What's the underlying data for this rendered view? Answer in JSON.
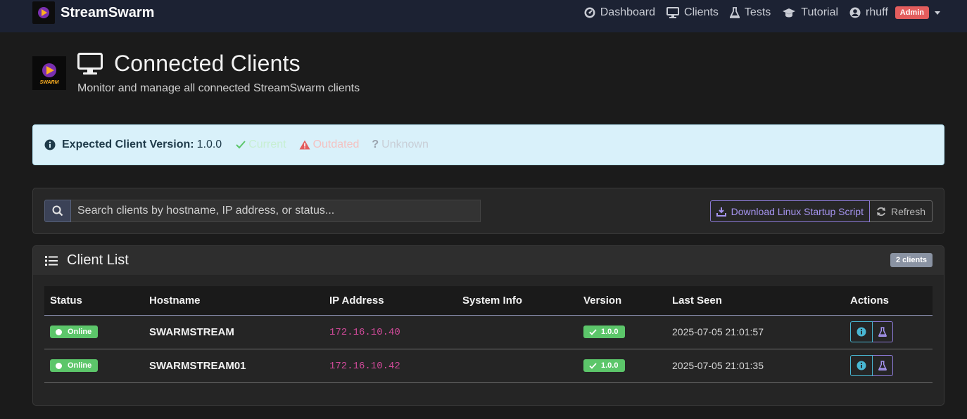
{
  "navbar": {
    "brand": "StreamSwarm",
    "logo_text": "SWARM",
    "links": [
      {
        "label": "Dashboard",
        "icon": "dashboard-icon"
      },
      {
        "label": "Clients",
        "icon": "monitor-icon"
      },
      {
        "label": "Tests",
        "icon": "flask-icon"
      },
      {
        "label": "Tutorial",
        "icon": "graduation-cap-icon"
      }
    ],
    "user": "rhuff",
    "role_badge": "Admin"
  },
  "header": {
    "title": "Connected Clients",
    "subtitle": "Monitor and manage all connected StreamSwarm clients",
    "logo_text": "SWARM"
  },
  "alert": {
    "label": "Expected Client Version:",
    "version": "1.0.0",
    "legend": {
      "current": "Current",
      "outdated": "Outdated",
      "unknown": "Unknown"
    }
  },
  "search": {
    "placeholder": "Search clients by hostname, IP address, or status...",
    "value": ""
  },
  "toolbar": {
    "download_label": "Download Linux Startup Script",
    "refresh_label": "Refresh"
  },
  "client_list": {
    "title": "Client List",
    "count_badge": "2 clients",
    "columns": [
      "Status",
      "Hostname",
      "IP Address",
      "System Info",
      "Version",
      "Last Seen",
      "Actions"
    ],
    "rows": [
      {
        "status": "Online",
        "hostname": "SWARMSTREAM",
        "ip": "172.16.10.40",
        "system_info": "",
        "version": "1.0.0",
        "last_seen": "2025-07-05 21:01:57"
      },
      {
        "status": "Online",
        "hostname": "SWARMSTREAM01",
        "ip": "172.16.10.42",
        "system_info": "",
        "version": "1.0.0",
        "last_seen": "2025-07-05 21:01:35"
      }
    ]
  },
  "colors": {
    "navbar_bg": "#1c2233",
    "page_bg": "#1b1b1b",
    "alert_bg": "#d9f1fa",
    "success": "#5cc66a",
    "danger": "#e35d5d",
    "accent_purple": "#8c7ad6",
    "ip_pink": "#d14a9a"
  }
}
